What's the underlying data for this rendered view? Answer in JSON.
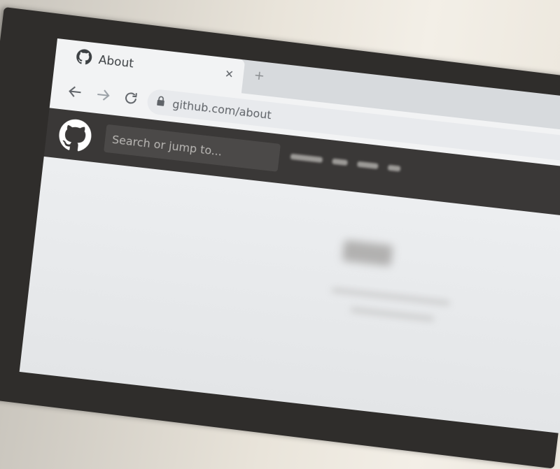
{
  "browser": {
    "tab_title": "About",
    "url": "github.com/about",
    "back_icon": "arrow-left-icon",
    "forward_icon": "arrow-right-icon",
    "reload_icon": "reload-icon",
    "lock_icon": "lock-icon"
  },
  "github": {
    "logo_icon": "github-octocat-icon",
    "search_placeholder": "Search or jump to..."
  }
}
